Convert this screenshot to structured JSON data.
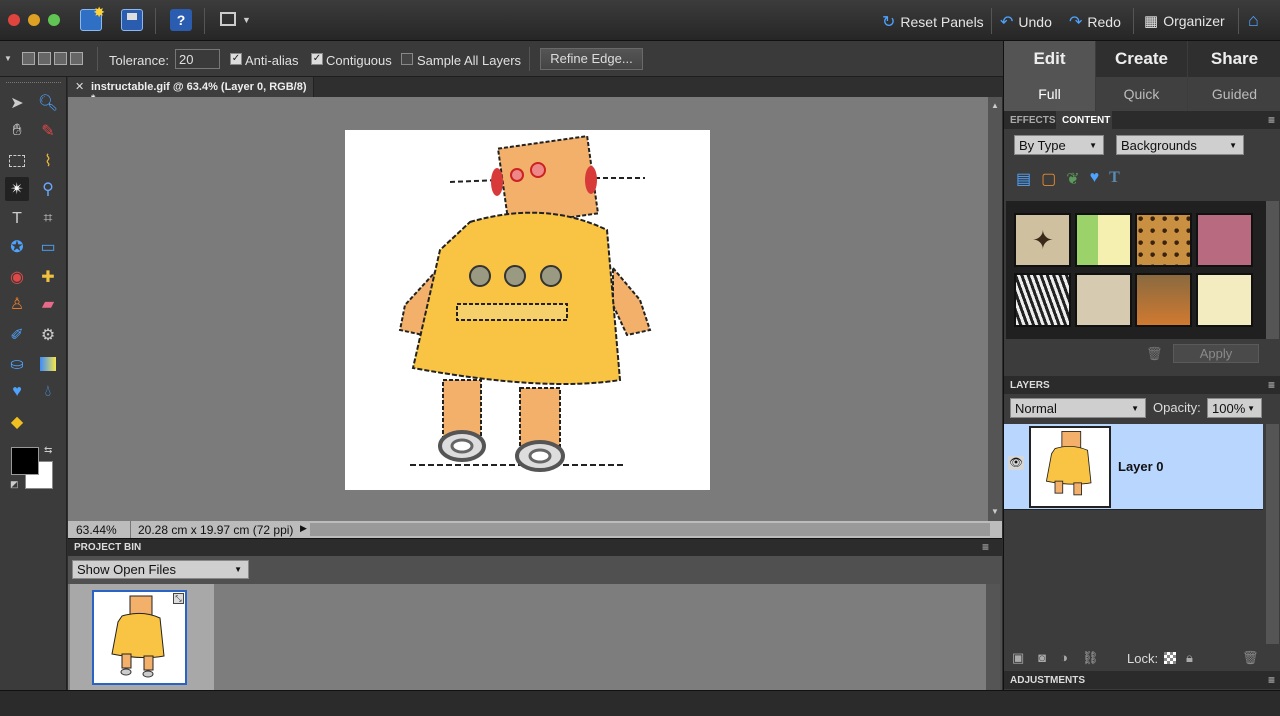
{
  "topbar": {
    "reset_panels": "Reset Panels",
    "undo": "Undo",
    "redo": "Redo",
    "organizer": "Organizer",
    "help": "?"
  },
  "options": {
    "tolerance_label": "Tolerance:",
    "tolerance_value": "20",
    "antialias": "Anti-alias",
    "contiguous": "Contiguous",
    "sample_all": "Sample All Layers",
    "refine_edge": "Refine Edge..."
  },
  "document": {
    "tab_title": "instructable.gif @ 63.4% (Layer 0, RGB/8) *",
    "zoom": "63.44%",
    "dimensions": "20.28 cm x 19.97 cm (72 ppi)"
  },
  "project_bin": {
    "title": "PROJECT BIN",
    "show": "Show Open Files"
  },
  "modes": {
    "edit": "Edit",
    "create": "Create",
    "share": "Share",
    "full": "Full",
    "quick": "Quick",
    "guided": "Guided"
  },
  "content_panel": {
    "tab_effects": "EFFECTS",
    "tab_content": "CONTENT",
    "filter_type": "By Type",
    "filter_category": "Backgrounds",
    "apply": "Apply"
  },
  "layers": {
    "title": "LAYERS",
    "blend": "Normal",
    "opacity_label": "Opacity:",
    "opacity_value": "100%",
    "layer_name": "Layer 0",
    "lock_label": "Lock:"
  },
  "adjustments": {
    "title": "ADJUSTMENTS"
  },
  "colors": {
    "accent_blue": "#4ea3ff",
    "layer_selected": "#b9d6ff",
    "robot_yellow": "#f9c443"
  }
}
